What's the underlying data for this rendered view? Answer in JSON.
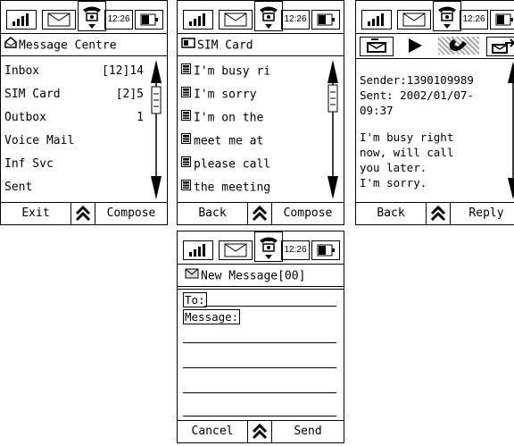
{
  "status": {
    "time": "12:26"
  },
  "message_centre": {
    "title": "Message Centre",
    "items": [
      {
        "label": "Inbox",
        "count": "[12]14"
      },
      {
        "label": "SIM Card",
        "count": "[2]5"
      },
      {
        "label": "Outbox",
        "count": "1"
      },
      {
        "label": "Voice Mail",
        "count": ""
      },
      {
        "label": "Inf Svc",
        "count": ""
      },
      {
        "label": "Sent",
        "count": ""
      }
    ],
    "left_softkey": "Exit",
    "right_softkey": "Compose"
  },
  "sim_card": {
    "title": "SIM Card",
    "items": [
      {
        "label": "I'm busy ri"
      },
      {
        "label": "I'm sorry"
      },
      {
        "label": "I'm on the"
      },
      {
        "label": "meet me at"
      },
      {
        "label": "please call"
      },
      {
        "label": "the meeting"
      }
    ],
    "left_softkey": "Back",
    "right_softkey": "Compose"
  },
  "message_view": {
    "sender_line": "Sender:1390109989",
    "sent_line1": "Sent: 2002/01/07-",
    "sent_line2": "09:37",
    "body": [
      "I'm busy right",
      "now, will call",
      "you later.",
      "I'm sorry."
    ],
    "left_softkey": "Back",
    "right_softkey": "Reply"
  },
  "new_message": {
    "title": "New Message[00]",
    "to_label": "To:",
    "message_label": "Message:",
    "left_softkey": "Cancel",
    "right_softkey": "Send"
  }
}
